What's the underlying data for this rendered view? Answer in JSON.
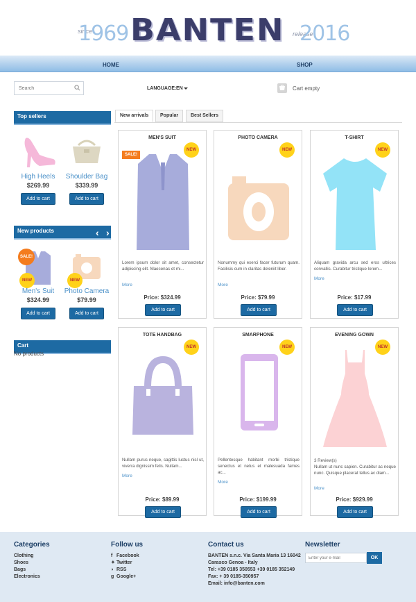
{
  "header": {
    "since_label": "since",
    "since_year": "1969",
    "logo": "BANTEN",
    "release_label": "release",
    "release_year": "2016"
  },
  "nav": {
    "items": [
      {
        "label": "HOME"
      },
      {
        "label": "SHOP"
      }
    ]
  },
  "toolbar": {
    "search_placeholder": "Search",
    "language_label": "LANGUAGE:",
    "language_value": "EN",
    "cart_status": "Cart empty"
  },
  "sidebar": {
    "top_sellers": {
      "title": "Top sellers",
      "items": [
        {
          "name": "High Heels",
          "price": "$269.99",
          "button": "Add to cart"
        },
        {
          "name": "Shoulder Bag",
          "price": "$339.99",
          "button": "Add to cart"
        }
      ]
    },
    "new_products": {
      "title": "New products",
      "items": [
        {
          "name": "Men's Suit",
          "price": "$324.99",
          "button": "Add to cart",
          "sale_badge": "SALE!",
          "new_badge": "NEW"
        },
        {
          "name": "Photo Camera",
          "price": "$79.99",
          "button": "Add to cart",
          "new_badge": "NEW"
        }
      ]
    },
    "cart": {
      "title": "Cart",
      "empty_text": "No products"
    }
  },
  "tabs": [
    {
      "label": "New arrivals",
      "active": true
    },
    {
      "label": "Popular",
      "active": false
    },
    {
      "label": "Best Sellers",
      "active": false
    }
  ],
  "products": [
    {
      "title": "MEN'S SUIT",
      "badge": "NEW",
      "sale": "SALE!",
      "desc": "Lorem ipsum dolor sit amet, consectetur adipiscing elit. Maecenas et mi...",
      "more": "More",
      "price": "Price: $324.99",
      "button": "Add to cart",
      "icon": "suit-icon",
      "color": "#a7acdb"
    },
    {
      "title": "PHOTO CAMERA",
      "badge": "NEW",
      "desc": "Nonummy qui exerci facer futurum quam. Facilisis cum in claritas deleniit liber.",
      "more": "More",
      "price": "Price: $79.99",
      "button": "Add to cart",
      "icon": "camera-icon",
      "color": "#f7d8bd"
    },
    {
      "title": "T-SHIRT",
      "badge": "NEW",
      "desc": "Aliquam gravida arcu sed eros ultrices convallis. Curabitur tristique lorem...",
      "more": "More",
      "price": "Price: $17.99",
      "button": "Add to cart",
      "icon": "tshirt-icon",
      "color": "#93e3f7"
    },
    {
      "title": "TOTE HANDBAG",
      "badge": "NEW",
      "desc": "Nullam purus neque, sagittis luctus nisl ut, viverra dignissim felis. Nullam...",
      "more": "More",
      "price": "Price: $89.99",
      "button": "Add to cart",
      "icon": "handbag-icon",
      "color": "#b9b3de"
    },
    {
      "title": "SMARPHONE",
      "badge": "NEW",
      "desc": "Pellentesque habitant morbi tristique senectus et netus et malesuada fames ac...",
      "more": "More",
      "price": "Price: $199.99",
      "button": "Add to cart",
      "icon": "smartphone-icon",
      "color": "#d9b6ec"
    },
    {
      "title": "EVENING GOWN",
      "badge": "NEW",
      "reviews": "3 Review(s)",
      "desc": "Nullam ut nunc sapien. Curabitur ac neque nunc. Quisque placerat tellus ac diam...",
      "more": "More",
      "price": "Price: $929.99",
      "button": "Add to cart",
      "icon": "gown-icon",
      "color": "#fcd2d4"
    }
  ],
  "footer": {
    "categories": {
      "title": "Categories",
      "items": [
        "Clothing",
        "Shoes",
        "Bags",
        "Electronics"
      ]
    },
    "follow": {
      "title": "Follow us",
      "items": [
        "Facebook",
        "Twitter",
        "RSS",
        "Google+"
      ]
    },
    "contact": {
      "title": "Contact us",
      "lines": [
        "BANTEN s.n.c. Via Santa Maria 13 16042",
        "Carasco Genoa - Italy",
        "Tel: +39 0185 350553 +39 0185 352149",
        "Fax: + 39 0185-350957",
        "Email: info@banten.com"
      ]
    },
    "newsletter": {
      "title": "Newsletter",
      "placeholder": "Enter your e-mail",
      "button": "OK"
    }
  }
}
